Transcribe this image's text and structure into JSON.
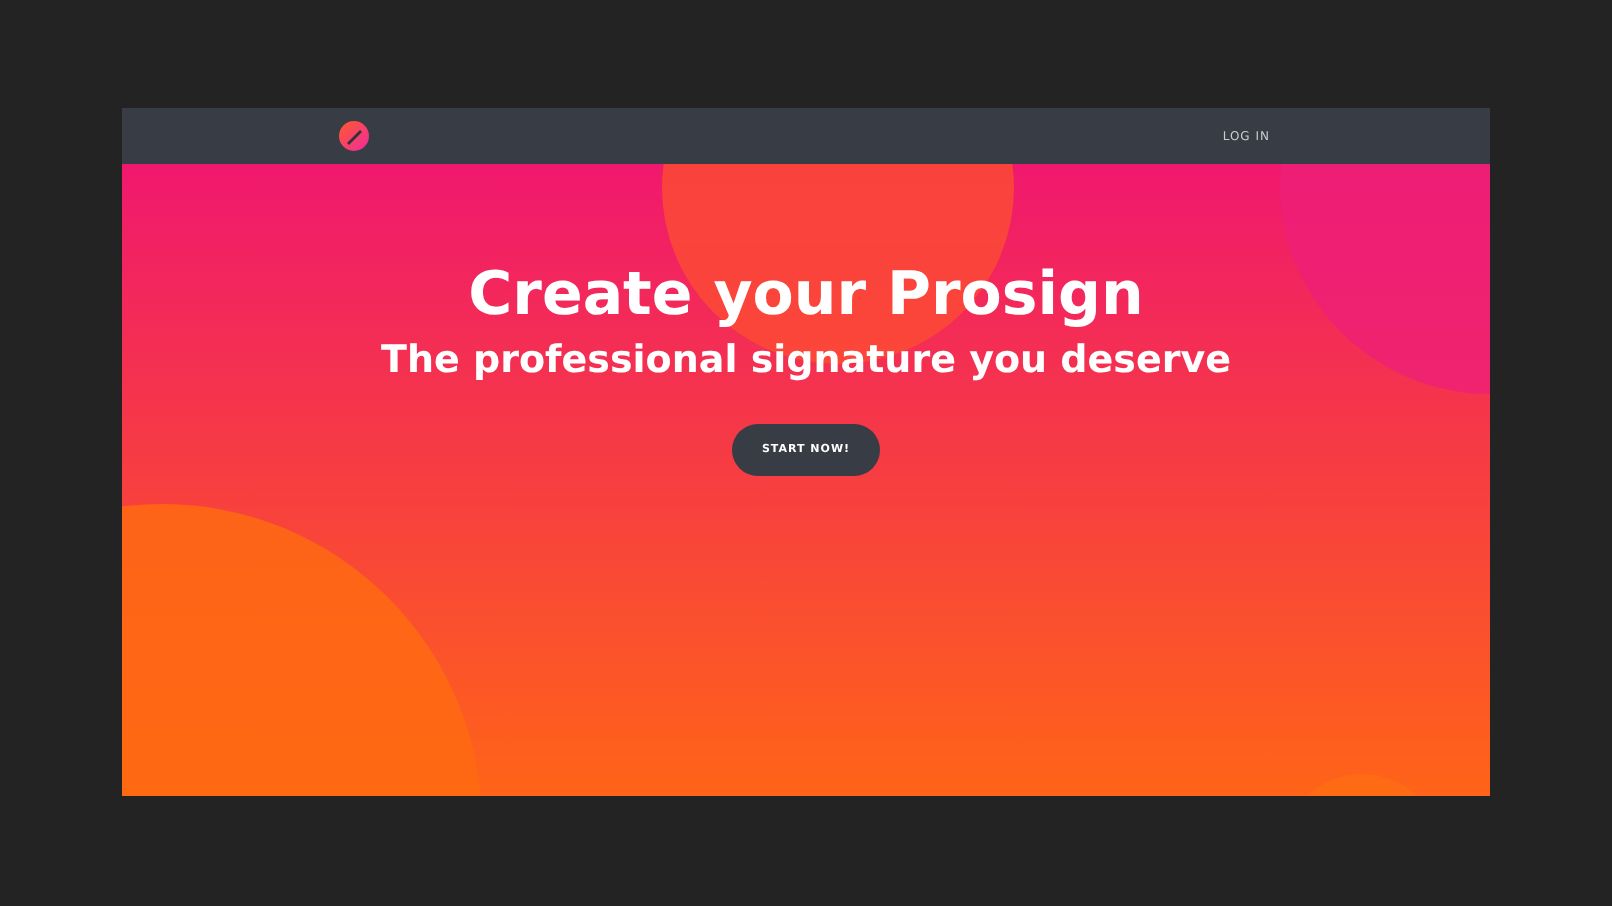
{
  "nav": {
    "login": "LOG IN"
  },
  "hero": {
    "title": "Create your Prosign",
    "subtitle": "The professional signature you deserve",
    "cta": "START NOW!"
  }
}
